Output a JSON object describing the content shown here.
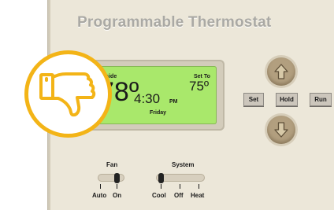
{
  "thermostat": {
    "title": "Programmable Thermostat",
    "display": {
      "inside_label": "Inside",
      "inside_temp": "78º",
      "time": "4:30",
      "ampm": "PM",
      "setto_label": "Set To",
      "set_temp": "75º",
      "day": "Friday"
    },
    "buttons": {
      "set": "Set",
      "hold": "Hold",
      "run": "Run"
    },
    "fan": {
      "label": "Fan",
      "options": [
        "Auto",
        "On"
      ],
      "selected": "On"
    },
    "system": {
      "label": "System",
      "options": [
        "Cool",
        "Off",
        "Heat"
      ],
      "selected": "Cool"
    }
  },
  "overlay": {
    "icon": "thumbs-down-icon",
    "color": "#f3b417"
  },
  "colors": {
    "lcd": "#a9e86b",
    "panel": "#ece7d9",
    "arrow_button": "#b29f7f"
  }
}
